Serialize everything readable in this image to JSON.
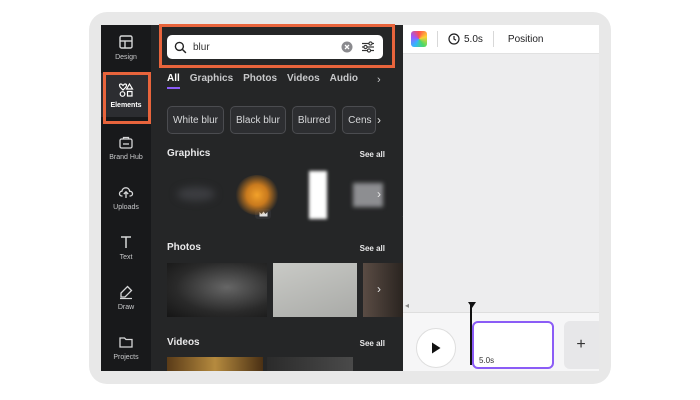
{
  "rail": {
    "items": [
      {
        "label": "Design",
        "icon": "layout-icon"
      },
      {
        "label": "Elements",
        "icon": "shapes-icon"
      },
      {
        "label": "Brand Hub",
        "icon": "brand-hub-icon"
      },
      {
        "label": "Uploads",
        "icon": "cloud-upload-icon"
      },
      {
        "label": "Text",
        "icon": "text-icon"
      },
      {
        "label": "Draw",
        "icon": "draw-icon"
      },
      {
        "label": "Projects",
        "icon": "folder-icon"
      }
    ],
    "active": "Elements"
  },
  "search": {
    "value": "blur",
    "placeholder": "Search elements"
  },
  "tabs": [
    "All",
    "Graphics",
    "Photos",
    "Videos",
    "Audio"
  ],
  "chips": [
    "White blur",
    "Black blur",
    "Blurred",
    "Cens"
  ],
  "sections": {
    "graphics": {
      "title": "Graphics",
      "see_all": "See all"
    },
    "photos": {
      "title": "Photos",
      "see_all": "See all"
    },
    "videos": {
      "title": "Videos",
      "see_all": "See all"
    }
  },
  "topbar": {
    "duration": "5.0s",
    "position_label": "Position"
  },
  "timeline": {
    "clip_duration": "5.0s",
    "add_label": "+"
  },
  "colors": {
    "accent_highlight": "#e8643c",
    "selection_purple": "#8b5cf6",
    "panel_bg": "#252627"
  }
}
